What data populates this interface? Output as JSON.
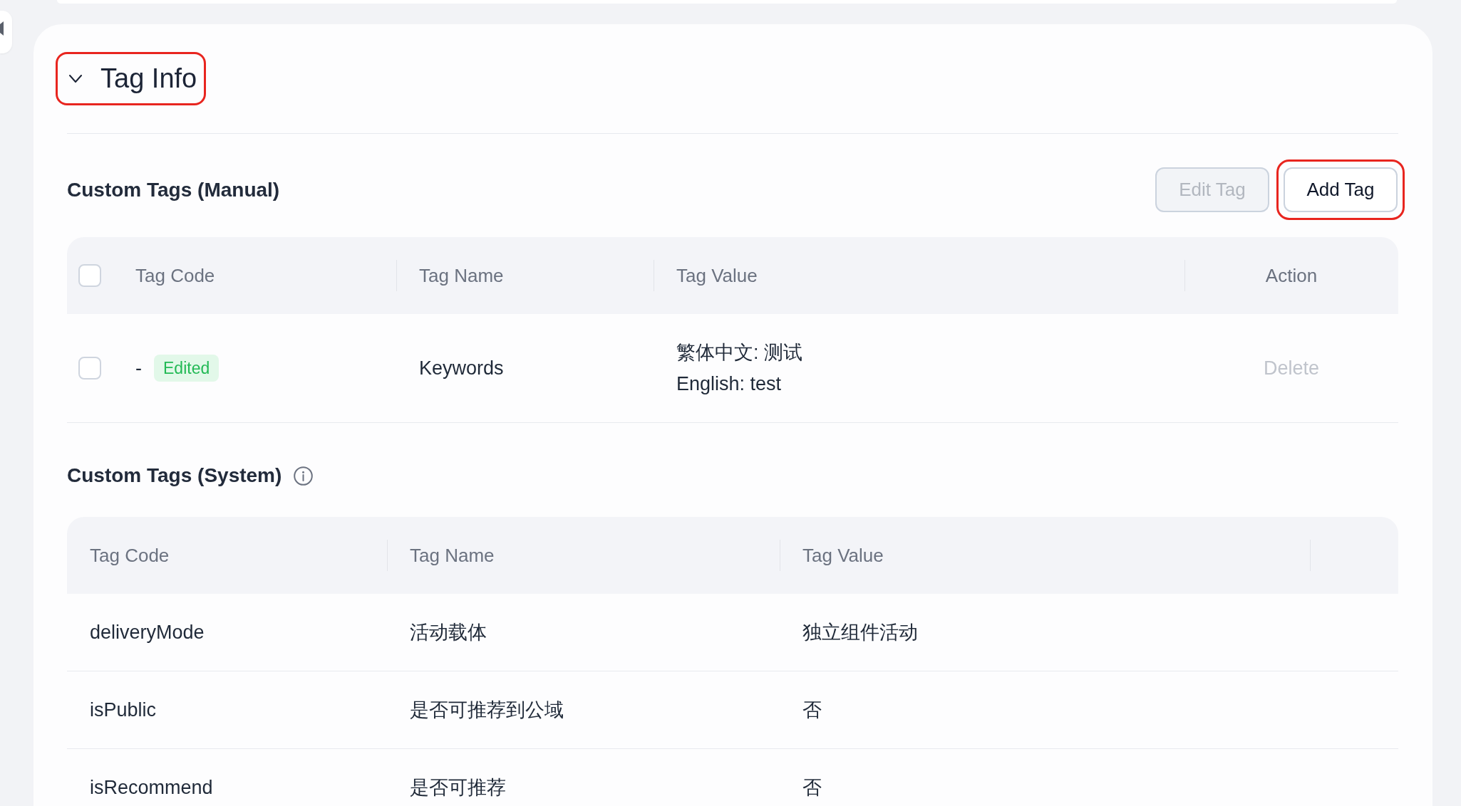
{
  "section": {
    "title": "Tag Info",
    "expanded": true,
    "highlighted": true
  },
  "manual_tags": {
    "title": "Custom Tags (Manual)",
    "buttons": [
      {
        "label": "Edit Tag",
        "disabled": true,
        "highlighted": false
      },
      {
        "label": "Add Tag",
        "disabled": false,
        "highlighted": true
      }
    ],
    "select_all": {
      "checked": false
    },
    "columns": [
      "Tag Code",
      "Tag Name",
      "Tag Value",
      "Action"
    ],
    "rows": [
      {
        "checked": false,
        "tag_code": "-",
        "status_badge": "Edited",
        "tag_name": "Keywords",
        "tag_value": [
          "繁体中文: 测试",
          "English: test"
        ],
        "action": {
          "label": "Delete",
          "disabled": true
        }
      }
    ]
  },
  "system_tags": {
    "title": "Custom Tags (System)",
    "columns": [
      "Tag Code",
      "Tag Name",
      "Tag Value"
    ],
    "rows": [
      {
        "tag_code": "deliveryMode",
        "tag_name": "活动载体",
        "tag_value": "独立组件活动"
      },
      {
        "tag_code": "isPublic",
        "tag_name": "是否可推荐到公域",
        "tag_value": "否"
      },
      {
        "tag_code": "isRecommend",
        "tag_name": "是否可推荐",
        "tag_value": "否"
      }
    ]
  }
}
